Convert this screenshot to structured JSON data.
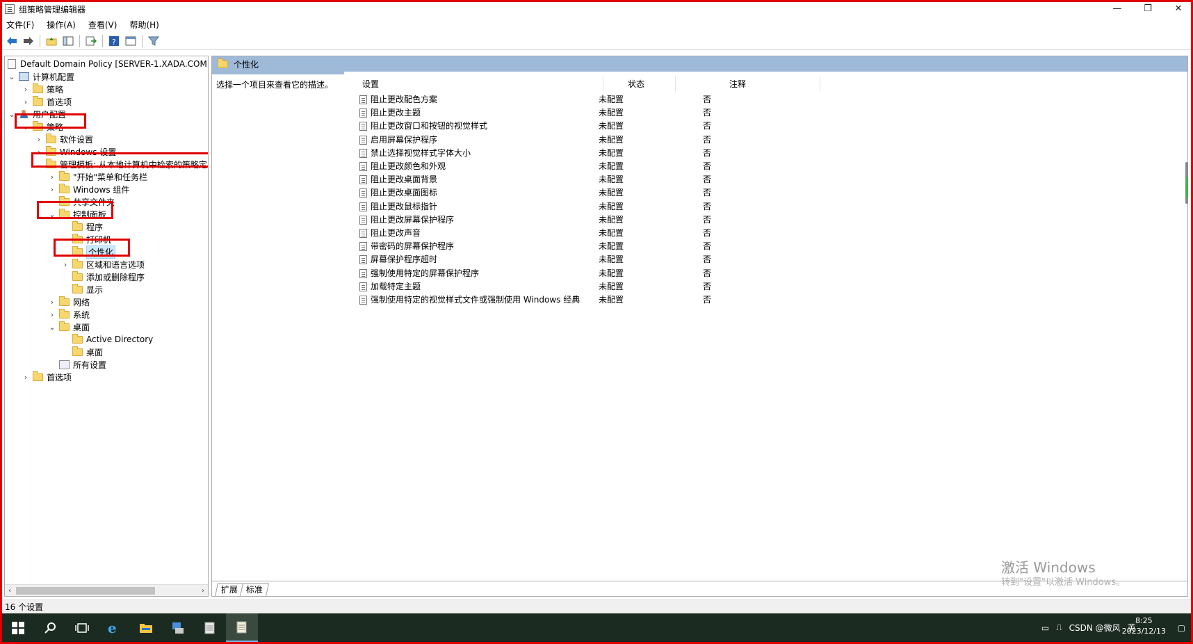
{
  "window": {
    "title": "组策略管理编辑器",
    "controls": [
      "—",
      "❐",
      "✕"
    ]
  },
  "menubar": [
    "文件(F)",
    "操作(A)",
    "查看(V)",
    "帮助(H)"
  ],
  "toolbar": {
    "icons": [
      "back-arrow-icon",
      "forward-arrow-icon",
      "up-folder-icon",
      "show-hide-tree-icon",
      "export-list-icon",
      "help-icon",
      "properties-icon",
      "filter-icon"
    ]
  },
  "tree": {
    "root": "Default Domain Policy [SERVER-1.XADA.COM]",
    "computer_config": "计算机配置",
    "cc_policies": "策略",
    "cc_preferences": "首选项",
    "user_config": "用户配置",
    "uc_policies": "策略",
    "software_settings": "软件设置",
    "windows_settings": "Windows 设置",
    "admin_templates": "管理模板: 从本地计算机中检索的策略定",
    "start_menu": "\"开始\"菜单和任务栏",
    "windows_components": "Windows 组件",
    "shared_folders": "共享文件夹",
    "control_panel": "控制面板",
    "programs": "程序",
    "printers": "打印机",
    "personalization": "个性化",
    "regional": "区域和语言选项",
    "add_remove": "添加或删除程序",
    "display": "显示",
    "network": "网络",
    "system": "系统",
    "desktop": "桌面",
    "active_directory": "Active Directory",
    "desktop_sub": "桌面",
    "all_settings": "所有设置",
    "uc_preferences": "首选项"
  },
  "right_pane": {
    "header_title": "个性化",
    "description": "选择一个项目来查看它的描述。",
    "columns": [
      "设置",
      "状态",
      "注释"
    ],
    "rows": [
      {
        "setting": "阻止更改配色方案",
        "state": "未配置",
        "comment": "否"
      },
      {
        "setting": "阻止更改主题",
        "state": "未配置",
        "comment": "否"
      },
      {
        "setting": "阻止更改窗口和按钮的视觉样式",
        "state": "未配置",
        "comment": "否"
      },
      {
        "setting": "启用屏幕保护程序",
        "state": "未配置",
        "comment": "否"
      },
      {
        "setting": "禁止选择视觉样式字体大小",
        "state": "未配置",
        "comment": "否"
      },
      {
        "setting": "阻止更改颜色和外观",
        "state": "未配置",
        "comment": "否"
      },
      {
        "setting": "阻止更改桌面背景",
        "state": "未配置",
        "comment": "否"
      },
      {
        "setting": "阻止更改桌面图标",
        "state": "未配置",
        "comment": "否"
      },
      {
        "setting": "阻止更改鼠标指针",
        "state": "未配置",
        "comment": "否"
      },
      {
        "setting": "阻止更改屏幕保护程序",
        "state": "未配置",
        "comment": "否"
      },
      {
        "setting": "阻止更改声音",
        "state": "未配置",
        "comment": "否"
      },
      {
        "setting": "带密码的屏幕保护程序",
        "state": "未配置",
        "comment": "否"
      },
      {
        "setting": "屏幕保护程序超时",
        "state": "未配置",
        "comment": "否"
      },
      {
        "setting": "强制使用特定的屏幕保护程序",
        "state": "未配置",
        "comment": "否"
      },
      {
        "setting": "加载特定主题",
        "state": "未配置",
        "comment": "否"
      },
      {
        "setting": "强制使用特定的视觉样式文件或强制使用 Windows 经典",
        "state": "未配置",
        "comment": "否"
      }
    ],
    "tabs": [
      "扩展",
      "标准"
    ]
  },
  "watermark": {
    "line1": "激活 Windows",
    "line2": "转到\"设置\"以激活 Windows。"
  },
  "statusbar": "16 个设置",
  "taskbar": {
    "tray_text": "CSDN @微风",
    "ime": "英",
    "time": "8:25",
    "date": "2023/12/13"
  },
  "colors": {
    "highlight_box": "#e00000",
    "pane_header": "#9fb9d8",
    "taskbar": "#1c2b21"
  }
}
